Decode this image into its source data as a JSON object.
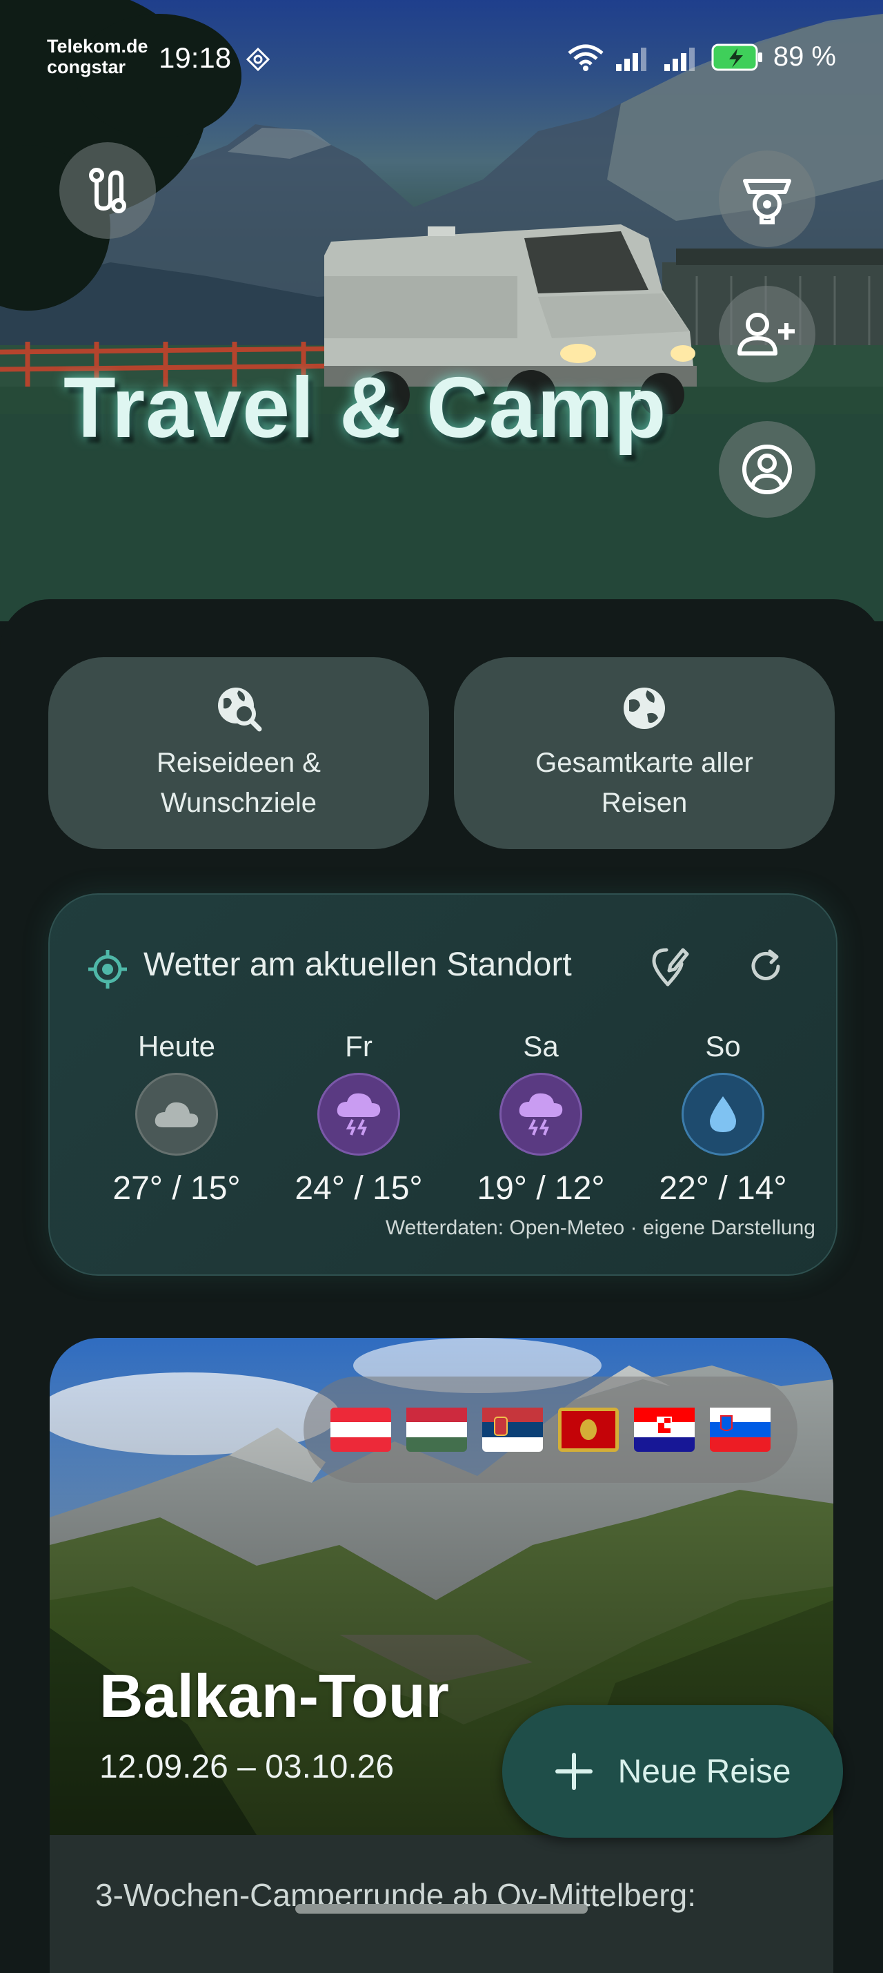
{
  "status_bar": {
    "carrier_line1": "Telekom.de",
    "carrier_line2": "congstar",
    "time": "19:18",
    "battery_percent": "89 %"
  },
  "hero": {
    "title": "Travel & Camp",
    "buttons": {
      "route": "route-icon",
      "camera": "camera-icon",
      "add_user": "add-user-icon",
      "profile": "profile-icon"
    }
  },
  "quick_actions": [
    {
      "label": "Reiseideen &\nWunschziele",
      "icon": "globe-search-icon"
    },
    {
      "label": "Gesamtkarte aller\nReisen",
      "icon": "globe-icon"
    }
  ],
  "weather": {
    "title": "Wetter am aktuellen Standort",
    "days": [
      {
        "name": "Heute",
        "temp": "27° / 15°",
        "icon": "cloud-icon"
      },
      {
        "name": "Fr",
        "temp": "24° / 15°",
        "icon": "thunderstorm-icon"
      },
      {
        "name": "Sa",
        "temp": "19° / 12°",
        "icon": "thunderstorm-icon"
      },
      {
        "name": "So",
        "temp": "22° / 14°",
        "icon": "rain-drop-icon"
      }
    ],
    "credit": "Wetterdaten: Open-Meteo · eigene Darstellung"
  },
  "trip": {
    "name": "Balkan-Tour",
    "dates": "12.09.26 – 03.10.26",
    "description": "3-Wochen-Camperrunde ab Oy-Mittelberg:",
    "flags": [
      "Austria",
      "Hungary",
      "Serbia",
      "Montenegro",
      "Croatia",
      "Slovenia"
    ]
  },
  "fab": {
    "label": "Neue Reise"
  },
  "colors": {
    "background": "#121a19",
    "card": "#3b4c4a",
    "weather_card": "#1f3838",
    "accent": "#4fb8a8",
    "fab": "#1f4e49"
  }
}
